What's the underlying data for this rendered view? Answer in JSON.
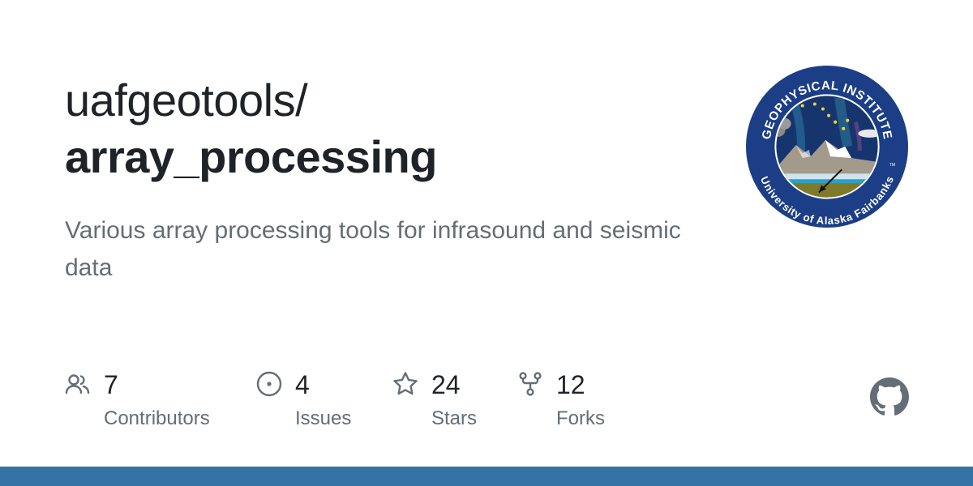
{
  "repo": {
    "owner": "uafgeotools/",
    "name": "array_processing",
    "description": "Various array processing tools for infrasound and seismic data"
  },
  "stats": [
    {
      "icon": "people-icon",
      "value": "7",
      "label": "Contributors"
    },
    {
      "icon": "issue-opened-icon",
      "value": "4",
      "label": "Issues"
    },
    {
      "icon": "star-icon",
      "value": "24",
      "label": "Stars"
    },
    {
      "icon": "repo-forked-icon",
      "value": "12",
      "label": "Forks"
    }
  ],
  "logo": {
    "top_text": "GEOPHYSICAL INSTITUTE",
    "bottom_text": "University of Alaska Fairbanks",
    "tm": "TM"
  },
  "colors": {
    "language_bar": "#3572a5",
    "text_primary": "#1f2328",
    "text_muted": "#656d76"
  }
}
